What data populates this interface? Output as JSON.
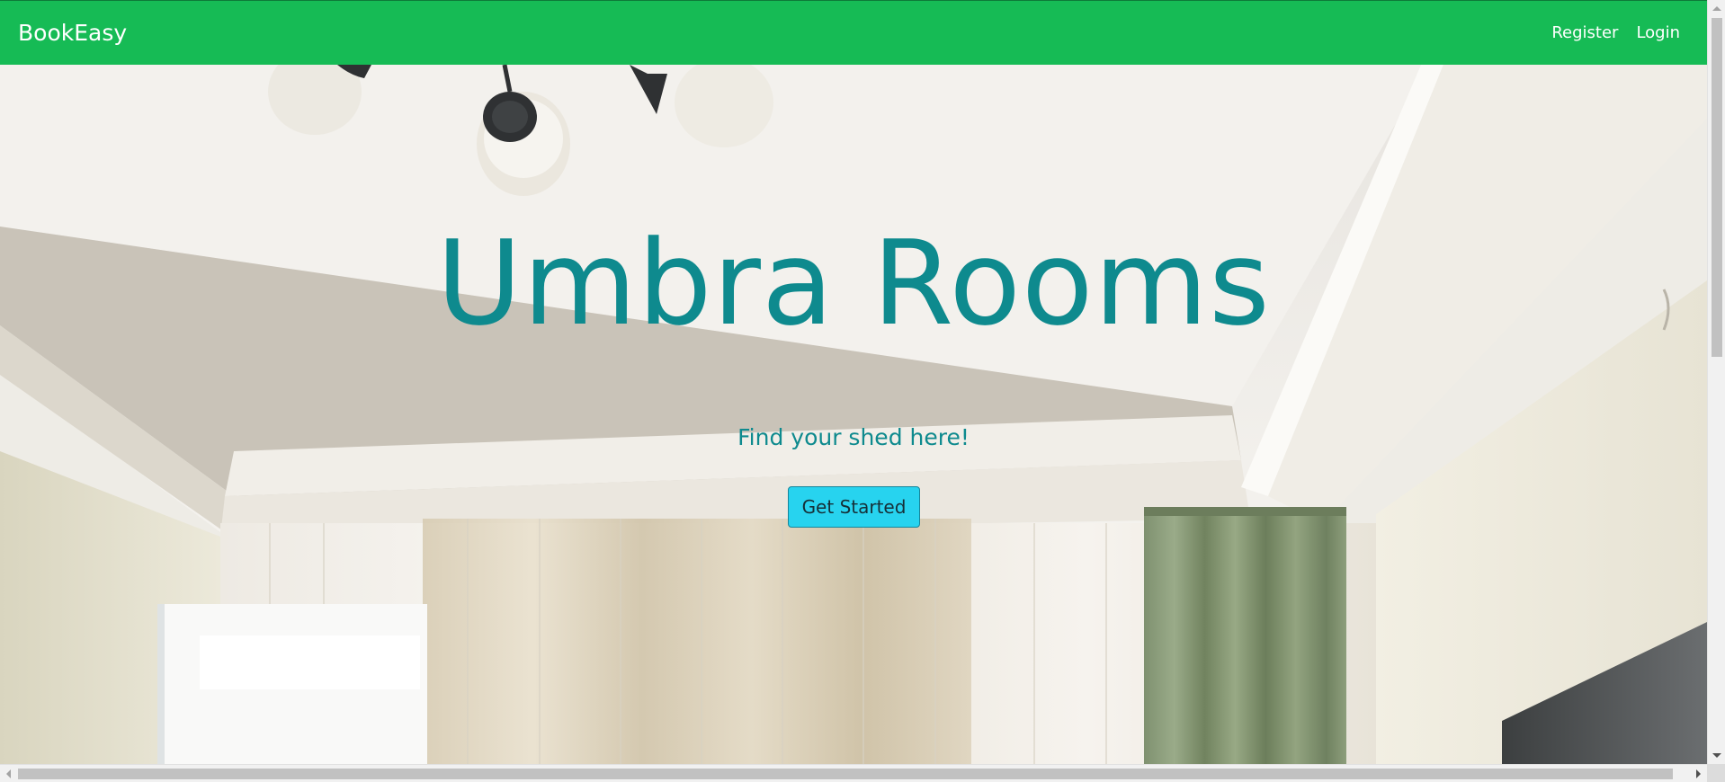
{
  "navbar": {
    "brand": "BookEasy",
    "links": [
      {
        "label": "Register"
      },
      {
        "label": "Login"
      }
    ],
    "background_color": "#16bb55"
  },
  "hero": {
    "title": "Umbra Rooms",
    "tagline": "Find your shed here!",
    "cta_label": "Get Started",
    "title_color": "#0e8a8e",
    "cta_color": "#27d3ef",
    "background_image": "room-interior-photo"
  }
}
